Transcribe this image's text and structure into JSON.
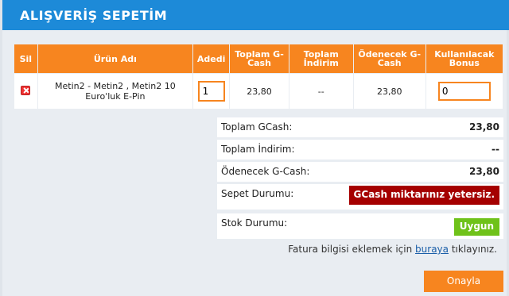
{
  "header": {
    "title": "ALIŞVERİŞ SEPETİM"
  },
  "table": {
    "columns": [
      "Sil",
      "Ürün Adı",
      "Adedi",
      "Toplam G-Cash",
      "Toplam İndirim",
      "Ödenecek G-Cash",
      "Kullanılacak Bonus"
    ],
    "rows": [
      {
        "product": "Metin2 - Metin2 , Metin2 10 Euro'luk E-Pin",
        "quantity": "1",
        "total_gcash": "23,80",
        "total_discount": "--",
        "payable_gcash": "23,80",
        "bonus": "0"
      }
    ]
  },
  "summary": {
    "total_gcash_label": "Toplam GCash:",
    "total_gcash_value": "23,80",
    "total_discount_label": "Toplam İndirim:",
    "total_discount_value": "--",
    "payable_label": "Ödenecek G-Cash:",
    "payable_value": "23,80",
    "cart_status_label": "Sepet Durumu:",
    "cart_status_value": "GCash miktarınız yetersiz.",
    "stock_status_label": "Stok Durumu:",
    "stock_status_value": "Uygun"
  },
  "invoice": {
    "prefix": "Fatura bilgisi eklemek için",
    "link": "buraya",
    "suffix": "tıklayınız."
  },
  "actions": {
    "approve_label": "Onayla"
  },
  "colors": {
    "header_blue": "#1d8ad8",
    "accent_orange": "#f7851f",
    "error_red": "#a50000",
    "ok_green": "#6fc21a"
  }
}
